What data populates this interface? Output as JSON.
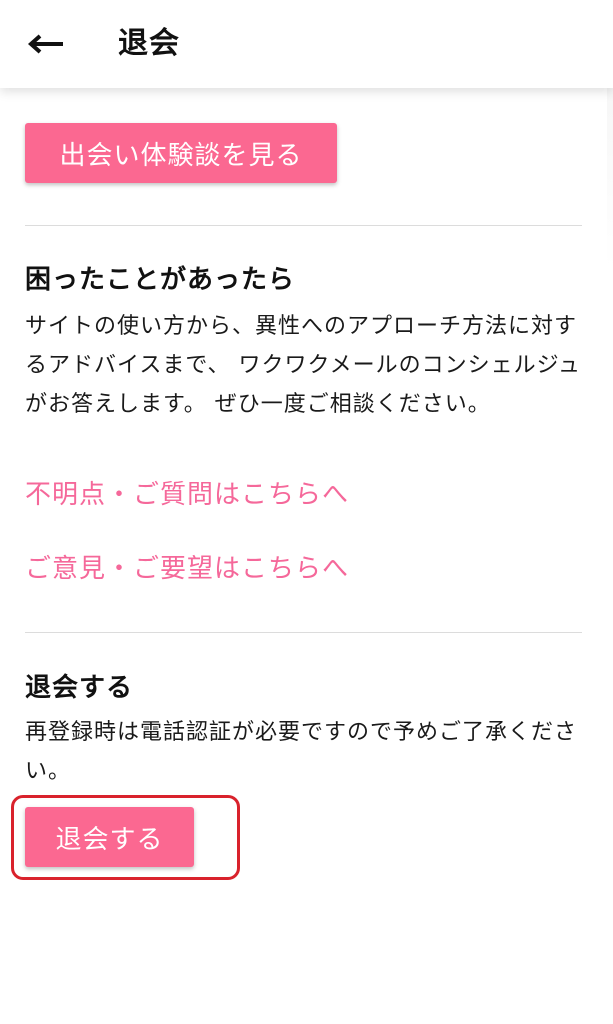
{
  "header": {
    "back_icon": "arrow-left-icon",
    "title": "退会"
  },
  "stories": {
    "button_label": "出会い体験談を見る"
  },
  "help": {
    "title": "困ったことがあったら",
    "body": "サイトの使い方から、異性へのアプローチ方法に対するアドバイスまで、 ワクワクメールのコンシェルジュがお答えします。 ぜひ一度ご相談ください。",
    "link_questions": "不明点・ご質問はこちらへ",
    "link_feedback": "ご意見・ご要望はこちらへ"
  },
  "withdraw": {
    "title": "退会する",
    "body": "再登録時は電話認証が必要ですので予めご了承ください。",
    "button_label": "退会する"
  },
  "colors": {
    "accent_pink": "#fb6891",
    "link_pink": "#f5689a",
    "highlight_red": "#d9222c",
    "divider": "#dcdcdc"
  }
}
